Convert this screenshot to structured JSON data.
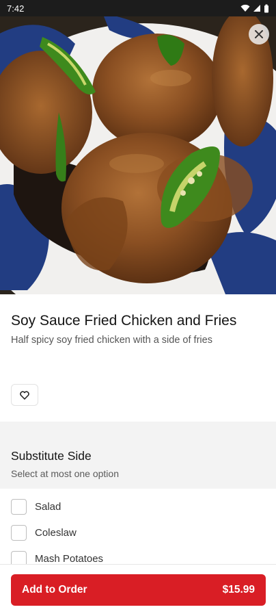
{
  "status_bar": {
    "time": "7:42",
    "icons": [
      "wifi-icon",
      "signal-icon",
      "battery-icon"
    ]
  },
  "hero": {
    "image": "soy sauce fried chicken photo"
  },
  "close_icon": "close-icon",
  "item": {
    "title": "Soy Sauce Fried Chicken and Fries",
    "description": "Half spicy soy fried chicken with a side of fries",
    "favorite_icon": "heart-icon"
  },
  "modifier": {
    "title": "Substitute Side",
    "subtitle": "Select at most one option",
    "options": [
      {
        "label": "Salad",
        "checked": false
      },
      {
        "label": "Coleslaw",
        "checked": false
      },
      {
        "label": "Mash Potatoes",
        "checked": false
      }
    ]
  },
  "footer": {
    "button_label": "Add to Order",
    "price": "$15.99"
  },
  "colors": {
    "accent": "#d91e25",
    "section_bg": "#f3f3f3"
  }
}
